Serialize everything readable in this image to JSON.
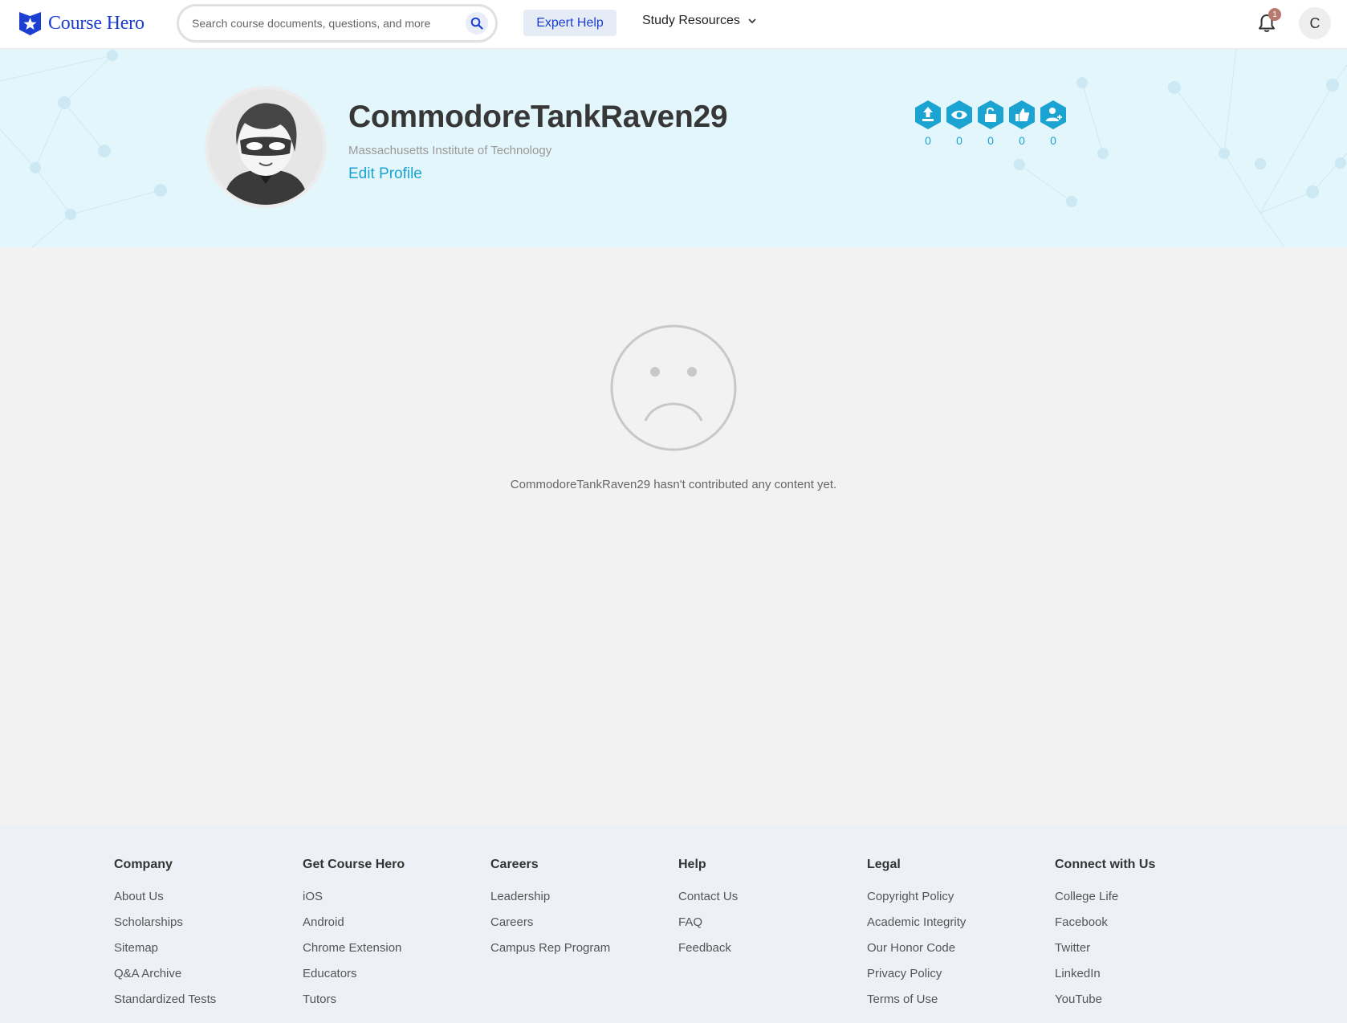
{
  "header": {
    "logo_text": "Course Hero",
    "search_placeholder": "Search course documents, questions, and more",
    "expert_help": "Expert Help",
    "study_resources": "Study Resources",
    "notification_count": "1",
    "user_initial": "C",
    "brand_color": "#1b3fd1"
  },
  "profile": {
    "username": "CommodoreTankRaven29",
    "school": "Massachusetts Institute of Technology",
    "edit_label": "Edit Profile",
    "stats": [
      {
        "icon": "upload-icon",
        "value": "0"
      },
      {
        "icon": "eye-icon",
        "value": "0"
      },
      {
        "icon": "unlock-icon",
        "value": "0"
      },
      {
        "icon": "thumbs-up-icon",
        "value": "0"
      },
      {
        "icon": "user-add-icon",
        "value": "0"
      }
    ],
    "accent_color": "#1ba3d1"
  },
  "empty_state": {
    "icon": "sad-face-icon",
    "message": "CommodoreTankRaven29 hasn't contributed any content yet."
  },
  "footer": {
    "columns": [
      {
        "title": "Company",
        "links": [
          "About Us",
          "Scholarships",
          "Sitemap",
          "Q&A Archive",
          "Standardized Tests"
        ]
      },
      {
        "title": "Get Course Hero",
        "links": [
          "iOS",
          "Android",
          "Chrome Extension",
          "Educators",
          "Tutors"
        ]
      },
      {
        "title": "Careers",
        "links": [
          "Leadership",
          "Careers",
          "Campus Rep Program"
        ]
      },
      {
        "title": "Help",
        "links": [
          "Contact Us",
          "FAQ",
          "Feedback"
        ]
      },
      {
        "title": "Legal",
        "links": [
          "Copyright Policy",
          "Academic Integrity",
          "Our Honor Code",
          "Privacy Policy",
          "Terms of Use"
        ]
      },
      {
        "title": "Connect with Us",
        "links": [
          "College Life",
          "Facebook",
          "Twitter",
          "LinkedIn",
          "YouTube"
        ]
      }
    ]
  }
}
